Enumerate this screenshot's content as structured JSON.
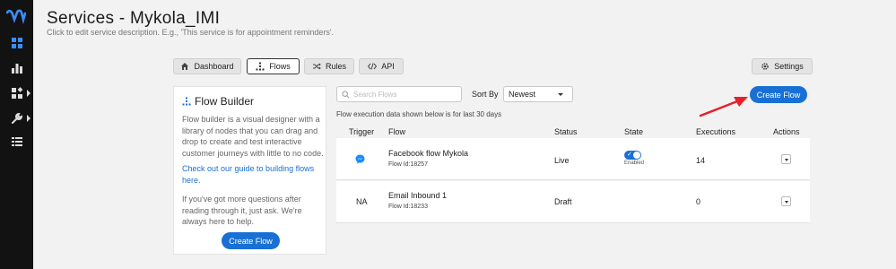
{
  "page": {
    "title": "Services - Mykola_IMI",
    "description": "Click to edit service description. E.g., 'This service is for appointment reminders'."
  },
  "nav": {
    "rail_icons": [
      "webex-logo",
      "dashboard-icon",
      "analytics-icon",
      "apps-icon",
      "wrench-icon",
      "list-icon"
    ]
  },
  "tabs": [
    {
      "label": "Dashboard",
      "icon": "home-icon"
    },
    {
      "label": "Flows",
      "icon": "flows-icon",
      "active": true
    },
    {
      "label": "Rules",
      "icon": "shuffle-icon"
    },
    {
      "label": "API",
      "icon": "code-icon"
    }
  ],
  "settings": {
    "label": "Settings",
    "icon": "gear-icon"
  },
  "flow_builder": {
    "title": "Flow Builder",
    "intro": "Flow builder is a visual designer with a library of nodes that you can drag and drop to create and test interactive customer journeys with little to no code.",
    "guide_link": "Check out our guide to building flows here.",
    "help": "If you've got more questions after reading through it, just ask. We're always here to help.",
    "button": "Create Flow"
  },
  "toolbar": {
    "search_placeholder": "Search Flows",
    "sort_label": "Sort By",
    "sort_value": "Newest",
    "create_button": "Create Flow",
    "note": "Flow execution data shown below is for last 30 days"
  },
  "table": {
    "headers": [
      "Trigger",
      "Flow",
      "Status",
      "State",
      "Executions",
      "Actions"
    ],
    "rows": [
      {
        "trigger": "messenger-icon",
        "trigger_text": "",
        "name": "Facebook flow Mykola",
        "id": "Flow Id:18257",
        "status": "Live",
        "state": "Enabled",
        "state_on": true,
        "executions": "14"
      },
      {
        "trigger": "",
        "trigger_text": "NA",
        "name": "Email Inbound 1",
        "id": "Flow Id:18233",
        "status": "Draft",
        "state": "",
        "state_on": false,
        "executions": "0"
      }
    ]
  },
  "colors": {
    "accent": "#1870d5",
    "rail": "#121212",
    "annotation_arrow": "#e8202a"
  }
}
